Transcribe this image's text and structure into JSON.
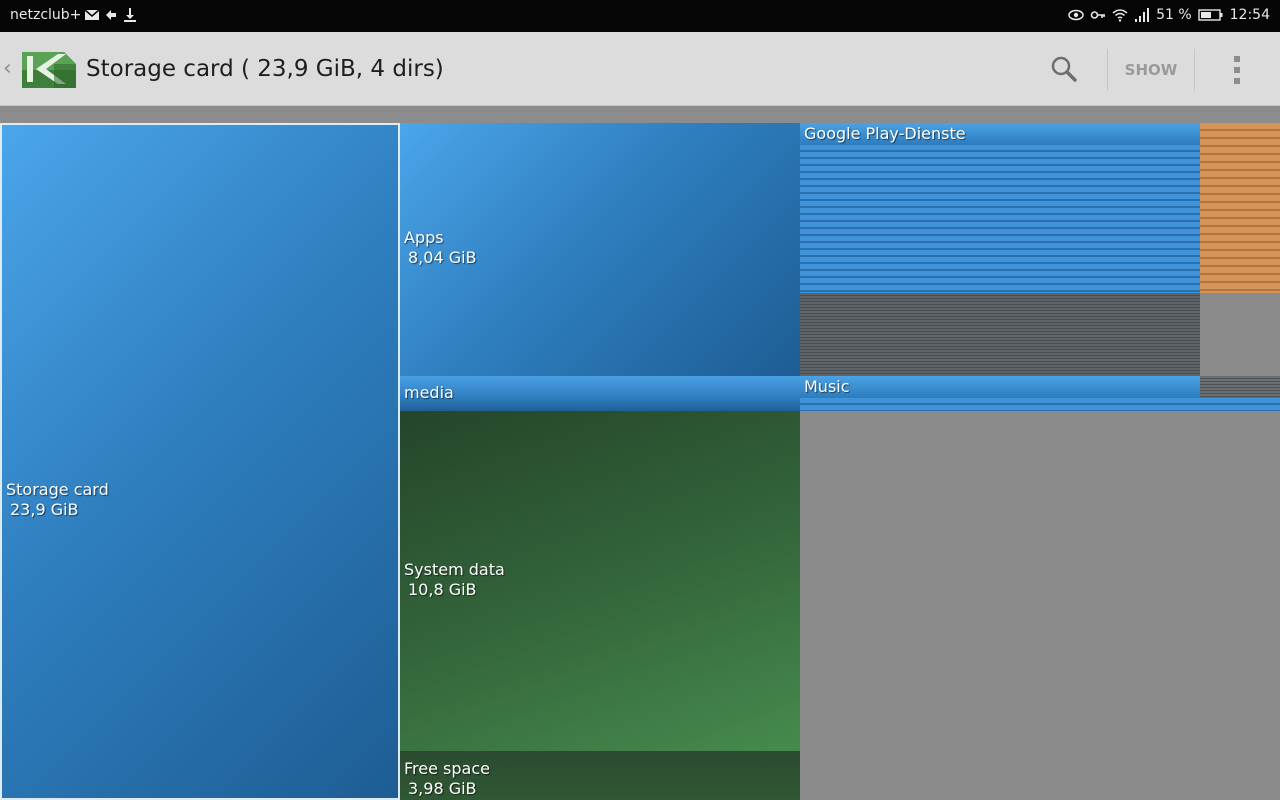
{
  "status_bar": {
    "carrier": "netzclub+",
    "battery_percent": "51 %",
    "time": "12:54",
    "left_icons": [
      "mail-icon",
      "sync-icon",
      "download-icon"
    ],
    "right_icons": [
      "eye-icon",
      "key-icon",
      "wifi-icon",
      "signal-icon",
      "battery-icon"
    ]
  },
  "action_bar": {
    "title": "Storage card ( 23,9 GiB, 4 dirs)",
    "show_label": "SHOW",
    "icons": [
      "back-chevron-icon",
      "app-logo-icon",
      "search-icon",
      "overflow-menu-icon"
    ]
  },
  "treemap": {
    "root": {
      "label": "Storage card",
      "size": "23,9 GiB"
    },
    "dirs": [
      {
        "label": "Apps",
        "size": "8,04 GiB"
      },
      {
        "label": "media",
        "size": ""
      },
      {
        "label": "System data",
        "size": "10,8 GiB"
      },
      {
        "label": "Free space",
        "size": "3,98 GiB"
      }
    ],
    "subdirs": [
      {
        "label": "Google Play-Dienste"
      },
      {
        "label": "Music"
      }
    ]
  },
  "colors": {
    "status_bar": "#050505",
    "action_bar": "#dcdcdc",
    "tile_blue": "#2f7fc0",
    "tile_green": "#33643a",
    "tile_orange": "#d79458",
    "background": "#8a8a8a"
  }
}
